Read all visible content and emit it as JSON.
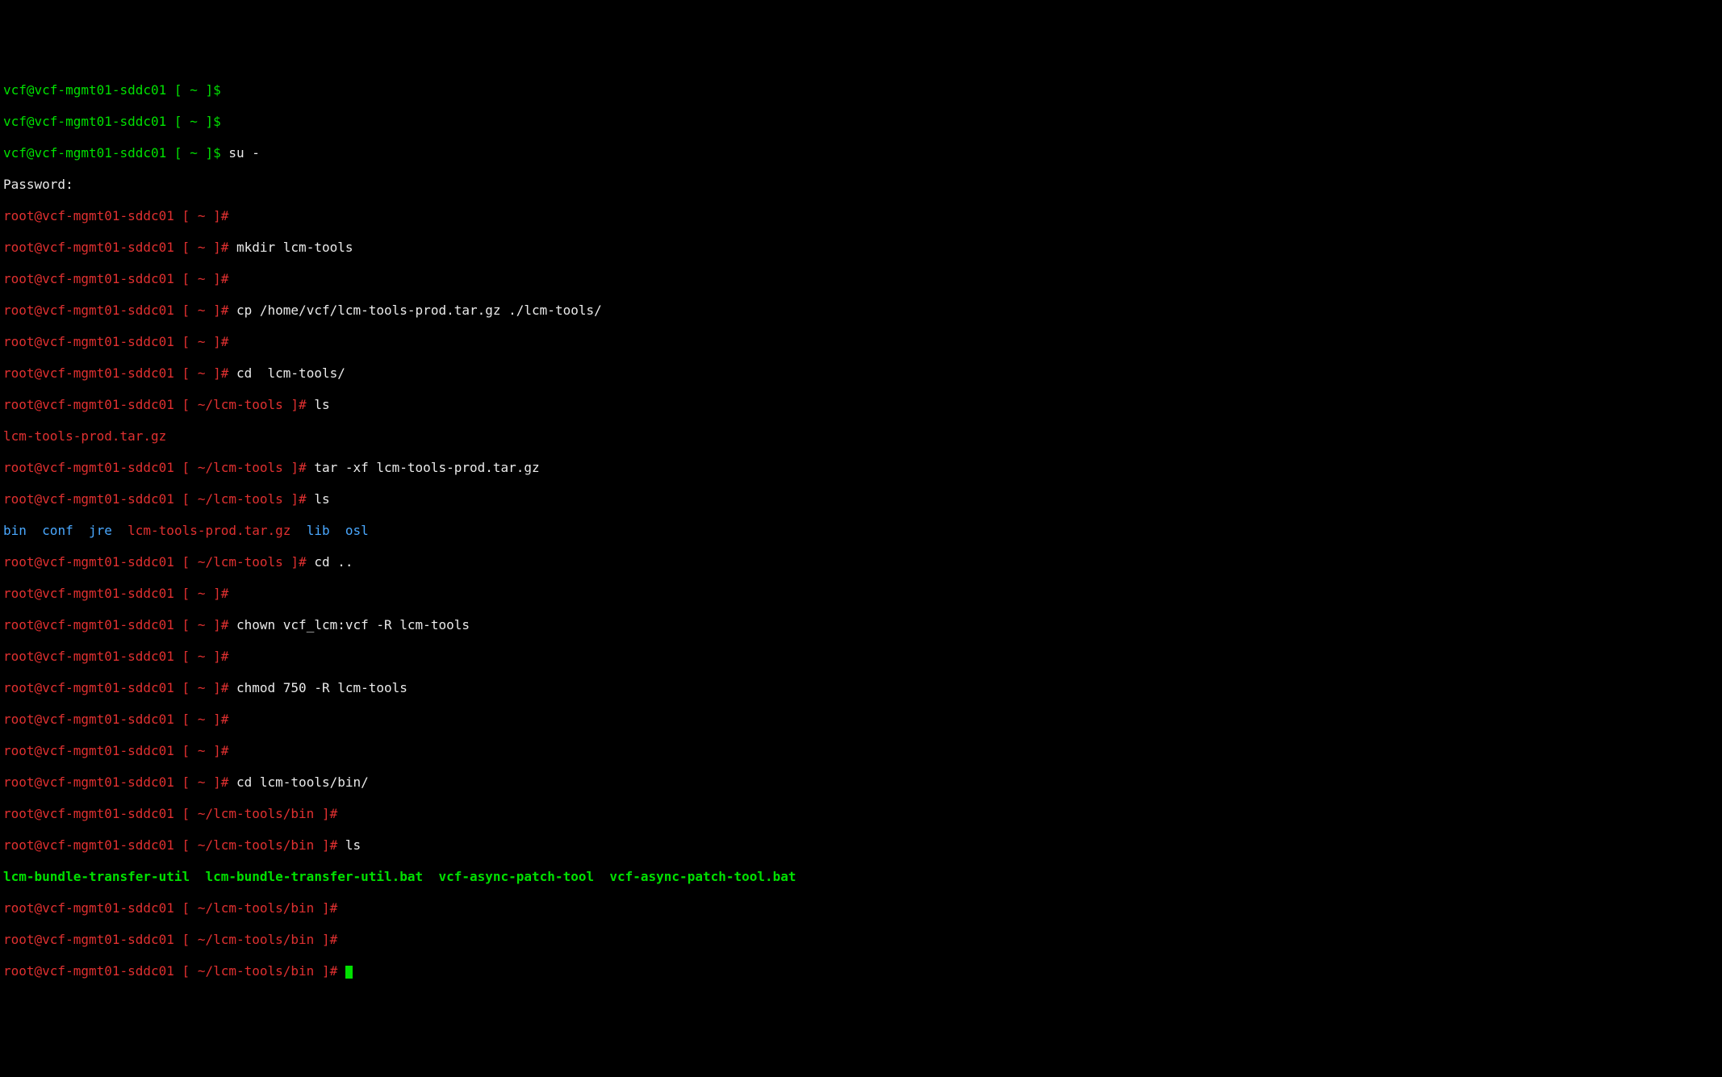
{
  "p_vcf": "vcf@vcf-mgmt01-sddc01",
  "p_root": "root@vcf-mgmt01-sddc01",
  "path_home": " [ ~ ]",
  "path_lcm": " [ ~/lcm-tools ]",
  "path_bin": " [ ~/lcm-tools/bin ]",
  "hash": "#",
  "dollar": "$",
  "cmd_su": " su -",
  "password_prompt": "Password:",
  "cmd_mkdir": " mkdir lcm-tools",
  "cmd_cp": " cp /home/vcf/lcm-tools-prod.tar.gz ./lcm-tools/",
  "cmd_cd_lcm": " cd  lcm-tools/",
  "cmd_ls": " ls",
  "ls_out1": "lcm-tools-prod.tar.gz",
  "cmd_tar": " tar -xf lcm-tools-prod.tar.gz",
  "ls2_bin": "bin",
  "ls2_conf": "conf",
  "ls2_jre": "jre",
  "ls2_tar": "lcm-tools-prod.tar.gz",
  "ls2_lib": "lib",
  "ls2_osl": "osl",
  "cmd_cdup": " cd ..",
  "cmd_chown": " chown vcf_lcm:vcf -R lcm-tools",
  "cmd_chmod": " chmod 750 -R lcm-tools",
  "cmd_cd_bin": " cd lcm-tools/bin/",
  "ls3_a": "lcm-bundle-transfer-util",
  "ls3_b": "lcm-bundle-transfer-util.bat",
  "ls3_c": "vcf-async-patch-tool",
  "ls3_d": "vcf-async-patch-tool.bat"
}
